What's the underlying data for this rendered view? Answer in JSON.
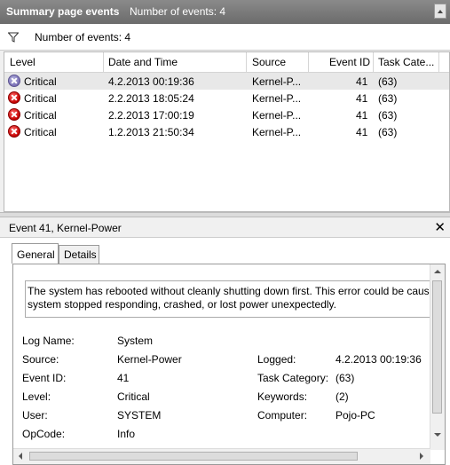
{
  "window": {
    "title": "Summary page events",
    "subtitle": "Number of events: 4"
  },
  "toolbar": {
    "filter_icon": "filter-icon",
    "count_text": "Number of events: 4"
  },
  "grid": {
    "columns": [
      "Level",
      "Date and Time",
      "Source",
      "Event ID",
      "Task Cate..."
    ],
    "rows": [
      {
        "level": "Critical",
        "datetime": "4.2.2013 00:19:36",
        "source": "Kernel-P...",
        "event_id": "41",
        "task": "(63)"
      },
      {
        "level": "Critical",
        "datetime": "2.2.2013 18:05:24",
        "source": "Kernel-P...",
        "event_id": "41",
        "task": "(63)"
      },
      {
        "level": "Critical",
        "datetime": "2.2.2013 17:00:19",
        "source": "Kernel-P...",
        "event_id": "41",
        "task": "(63)"
      },
      {
        "level": "Critical",
        "datetime": "1.2.2013 21:50:34",
        "source": "Kernel-P...",
        "event_id": "41",
        "task": "(63)"
      }
    ]
  },
  "detail": {
    "title": "Event 41, Kernel-Power",
    "close": "✕",
    "tabs": [
      "General",
      "Details"
    ],
    "message": "The system has rebooted without cleanly shutting down first. This error could be cause",
    "message2": "system stopped responding, crashed, or lost power unexpectedly.",
    "fields": {
      "log_name_label": "Log Name:",
      "log_name": "System",
      "source_label": "Source:",
      "source": "Kernel-Power",
      "logged_label": "Logged:",
      "logged": "4.2.2013 00:19:36",
      "event_id_label": "Event ID:",
      "event_id": "41",
      "task_category_label": "Task Category:",
      "task_category": "(63)",
      "level_label": "Level:",
      "level": "Critical",
      "keywords_label": "Keywords:",
      "keywords": "(2)",
      "user_label": "User:",
      "user": "SYSTEM",
      "computer_label": "Computer:",
      "computer": "Pojo-PC",
      "opcode_label": "OpCode:",
      "opcode": "Info"
    }
  }
}
